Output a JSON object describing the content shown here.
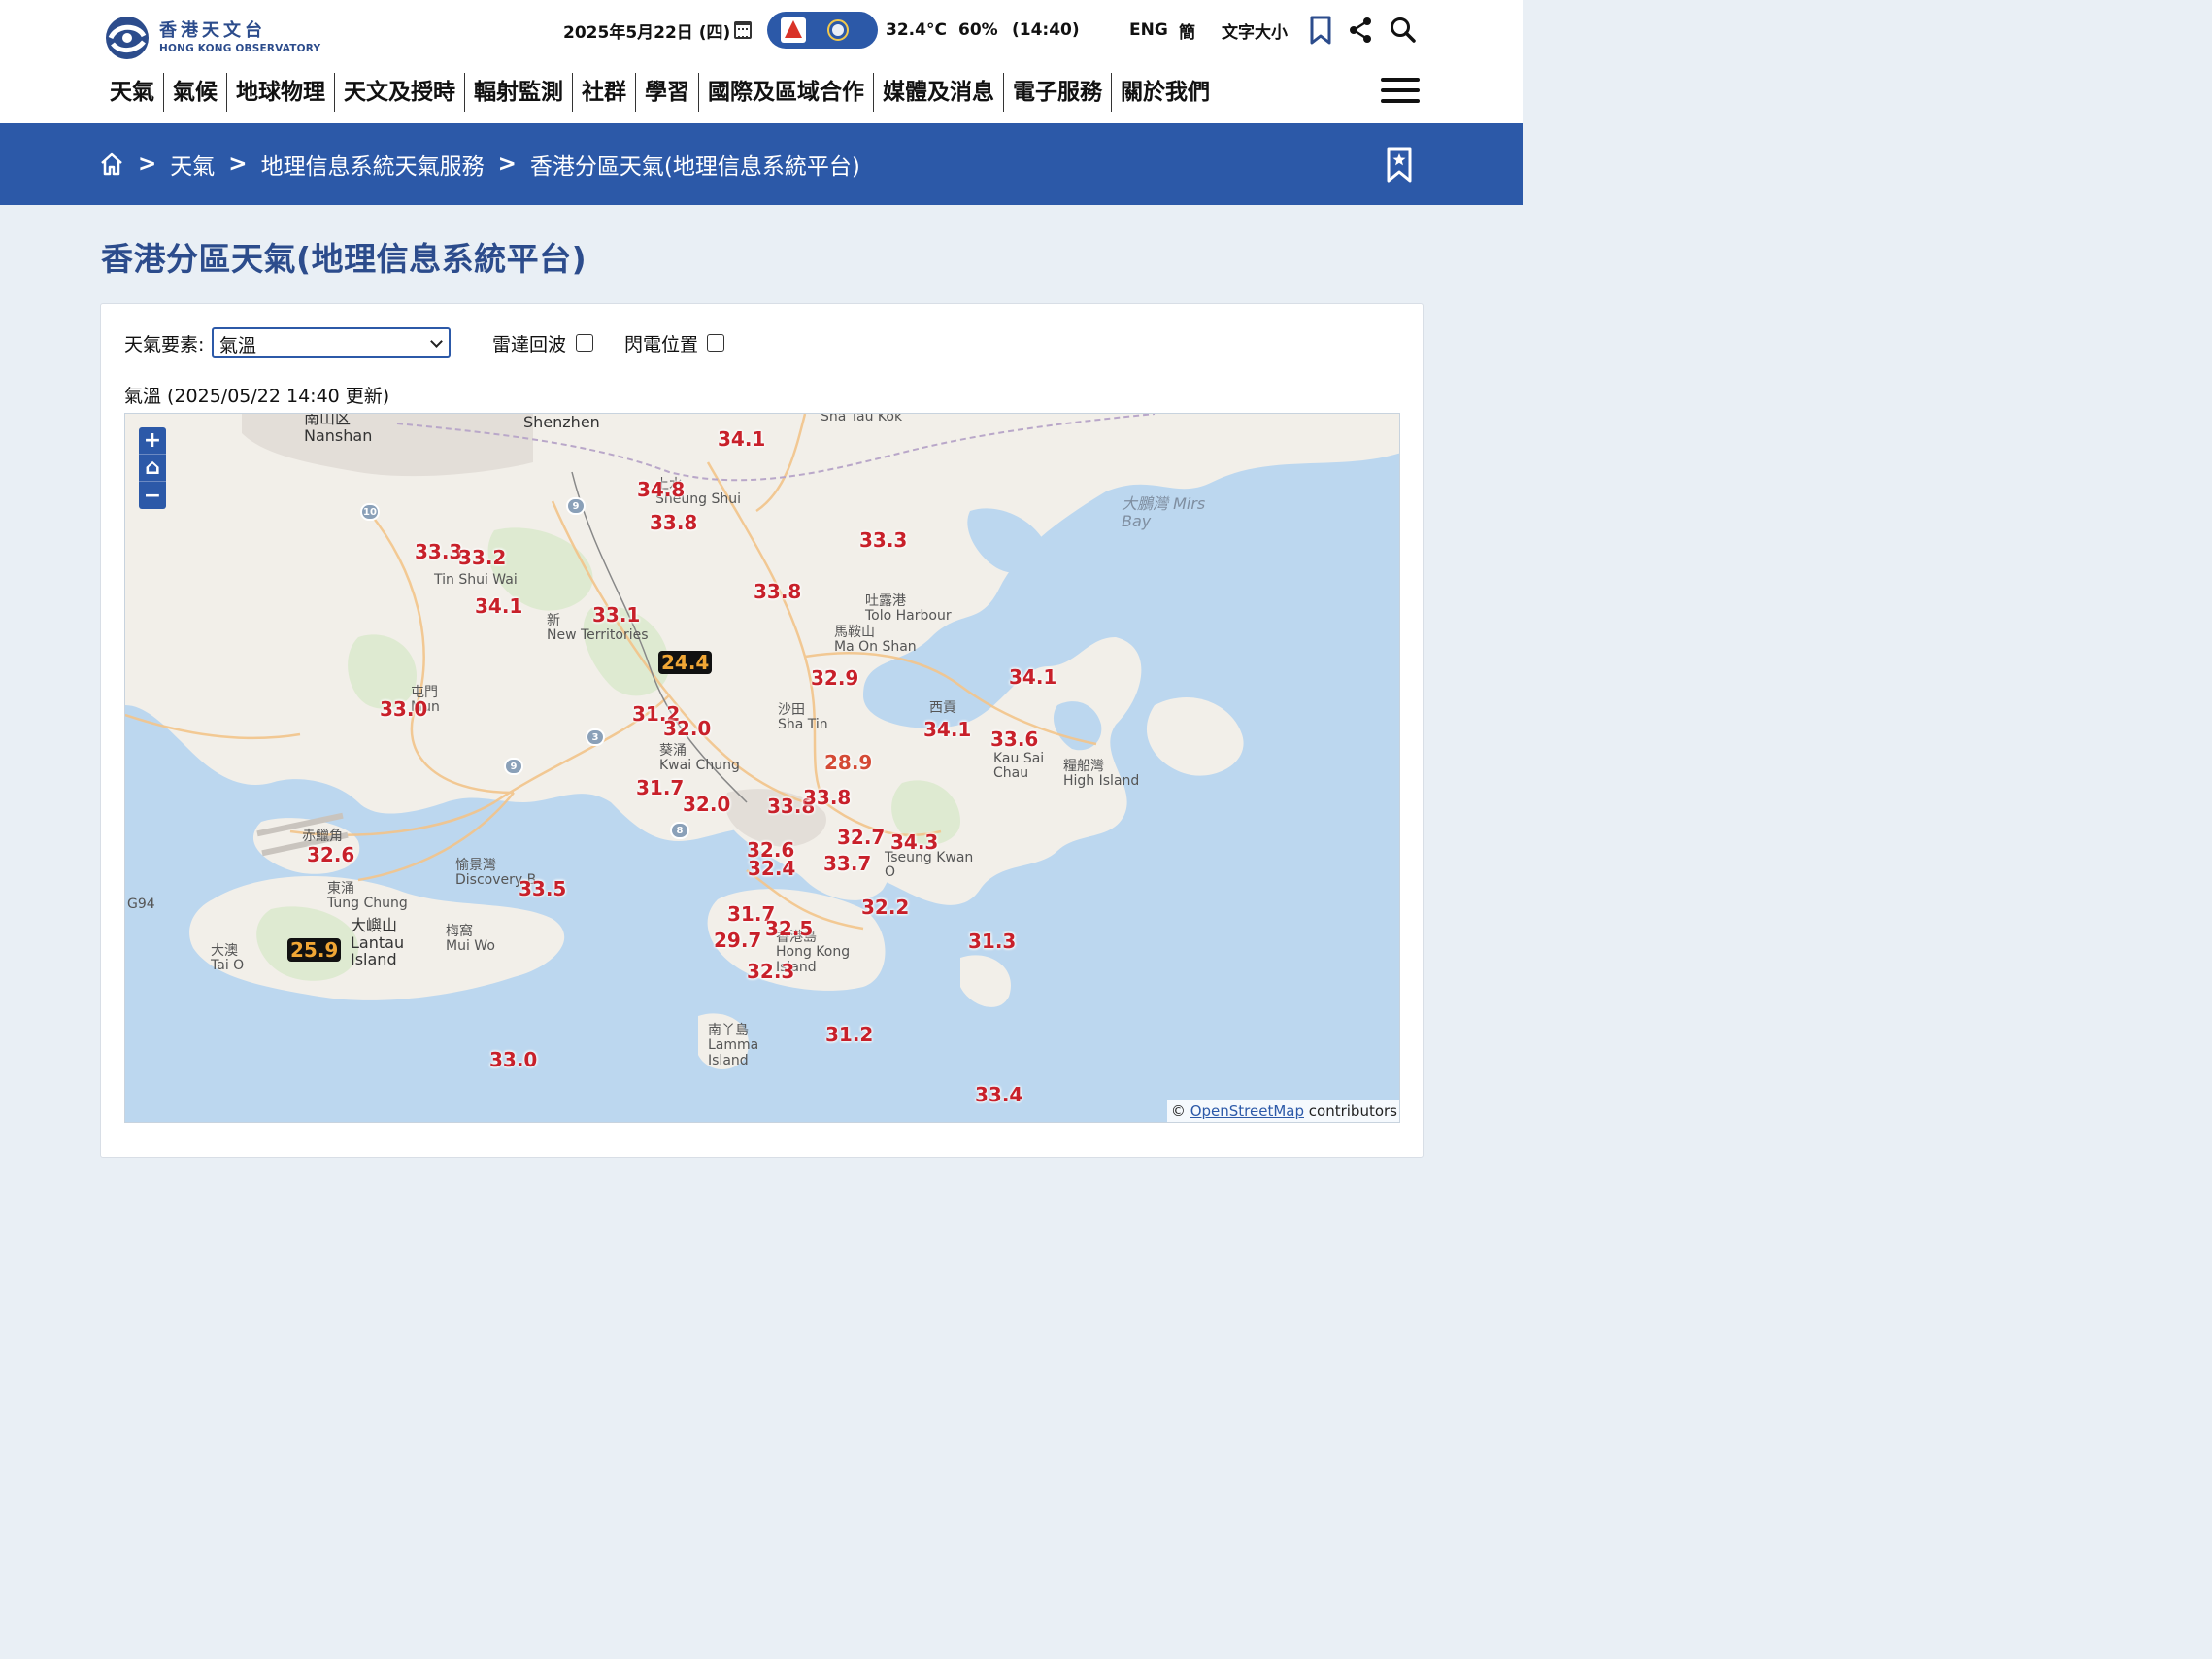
{
  "header": {
    "logo_cn": "香港天文台",
    "logo_en": "HONG KONG OBSERVATORY",
    "date": "2025年5月22日 (四)",
    "temperature": "32.4°C",
    "humidity": "60%",
    "time": "(14:40)",
    "lang_eng": "ENG",
    "lang_simp": "簡",
    "font_size": "文字大小"
  },
  "nav": [
    "天氣",
    "氣候",
    "地球物理",
    "天文及授時",
    "輻射監測",
    "社群",
    "學習",
    "國際及區域合作",
    "媒體及消息",
    "電子服務",
    "關於我們"
  ],
  "breadcrumb": [
    "天氣",
    "地理信息系統天氣服務",
    "香港分區天氣(地理信息系統平台)"
  ],
  "page_title": "香港分區天氣(地理信息系統平台)",
  "controls": {
    "element_label": "天氣要素:",
    "element_value": "氣溫",
    "radar_label": "雷達回波",
    "lightning_label": "閃電位置"
  },
  "map_caption": "氣溫 (2025/05/22 14:40 更新)",
  "map": {
    "places": [
      {
        "id": "nanshan",
        "text": "南山区\nNanshan"
      },
      {
        "id": "shenzhen",
        "text": "Shenzhen"
      },
      {
        "id": "shataukok",
        "text": "Sha Tau Kok"
      },
      {
        "id": "sheungshui",
        "text": "上水\nSheung Shui"
      },
      {
        "id": "mirsbay",
        "text": "大鵬灣 Mirs\nBay"
      },
      {
        "id": "tinshuiwai",
        "text": "Tin Shui Wai"
      },
      {
        "id": "newterritories",
        "text": "新\nNew Territories"
      },
      {
        "id": "toloharbour",
        "text": "吐露港\nTolo Harbour"
      },
      {
        "id": "maonshan",
        "text": "馬鞍山\nMa On Shan"
      },
      {
        "id": "tuenmun",
        "text": "屯門\nMun"
      },
      {
        "id": "shatin",
        "text": "沙田\nSha Tin"
      },
      {
        "id": "saikung",
        "text": "西貢"
      },
      {
        "id": "kousaichau",
        "text": "Kau Sai\nChau"
      },
      {
        "id": "highisland",
        "text": "糧船灣\nHigh Island"
      },
      {
        "id": "kwaichung",
        "text": "葵涌\nKwai Chung"
      },
      {
        "id": "chekLapKok",
        "text": "赤鱲角"
      },
      {
        "id": "discoverybay",
        "text": "愉景灣\nDiscovery B"
      },
      {
        "id": "tungchung",
        "text": "東涌\nTung Chung"
      },
      {
        "id": "lantau",
        "text": "大嶼山\nLantau\nIsland"
      },
      {
        "id": "muiwo",
        "text": "梅窩\nMui Wo"
      },
      {
        "id": "taio",
        "text": "大澳\nTai O"
      },
      {
        "id": "tseungkwan",
        "text": "Tseung Kwan\nO"
      },
      {
        "id": "hkisland",
        "text": "香港島\nHong Kong\nIsland"
      },
      {
        "id": "lamma",
        "text": "南丫島\nLamma\nIsland"
      },
      {
        "id": "g94",
        "text": "G94"
      }
    ],
    "readings": [
      {
        "v": "34.1",
        "kind": "normal"
      },
      {
        "v": "34.8",
        "kind": "normal"
      },
      {
        "v": "33.8",
        "kind": "normal"
      },
      {
        "v": "33.3",
        "kind": "normal"
      },
      {
        "v": "33.3",
        "kind": "normal"
      },
      {
        "v": "33.2",
        "kind": "normal"
      },
      {
        "v": "33.8",
        "kind": "normal"
      },
      {
        "v": "34.1",
        "kind": "normal"
      },
      {
        "v": "33.1",
        "kind": "normal"
      },
      {
        "v": "24.4",
        "kind": "low"
      },
      {
        "v": "32.9",
        "kind": "normal"
      },
      {
        "v": "34.1",
        "kind": "normal"
      },
      {
        "v": "33.0",
        "kind": "normal"
      },
      {
        "v": "31.2",
        "kind": "normal"
      },
      {
        "v": "32.0",
        "kind": "normal"
      },
      {
        "v": "34.1",
        "kind": "normal"
      },
      {
        "v": "33.6",
        "kind": "normal"
      },
      {
        "v": "28.9",
        "kind": "green"
      },
      {
        "v": "31.7",
        "kind": "normal"
      },
      {
        "v": "32.0",
        "kind": "normal"
      },
      {
        "v": "33.8",
        "kind": "normal"
      },
      {
        "v": "33.8",
        "kind": "normal"
      },
      {
        "v": "32.7",
        "kind": "normal"
      },
      {
        "v": "34.3",
        "kind": "normal"
      },
      {
        "v": "32.6",
        "kind": "normal"
      },
      {
        "v": "32.6",
        "kind": "normal"
      },
      {
        "v": "32.4",
        "kind": "normal"
      },
      {
        "v": "33.7",
        "kind": "normal"
      },
      {
        "v": "33.5",
        "kind": "normal"
      },
      {
        "v": "32.2",
        "kind": "normal"
      },
      {
        "v": "25.9",
        "kind": "low"
      },
      {
        "v": "31.7",
        "kind": "normal"
      },
      {
        "v": "32.5",
        "kind": "normal"
      },
      {
        "v": "29.7",
        "kind": "normal"
      },
      {
        "v": "31.3",
        "kind": "normal"
      },
      {
        "v": "32.3",
        "kind": "normal"
      },
      {
        "v": "31.2",
        "kind": "normal"
      },
      {
        "v": "33.0",
        "kind": "normal"
      },
      {
        "v": "33.4",
        "kind": "normal"
      }
    ],
    "attribution_prefix": "©",
    "attribution_link": "OpenStreetMap",
    "attribution_suffix": "contributors",
    "route_badges": [
      "10",
      "9",
      "3",
      "9",
      "8"
    ]
  }
}
